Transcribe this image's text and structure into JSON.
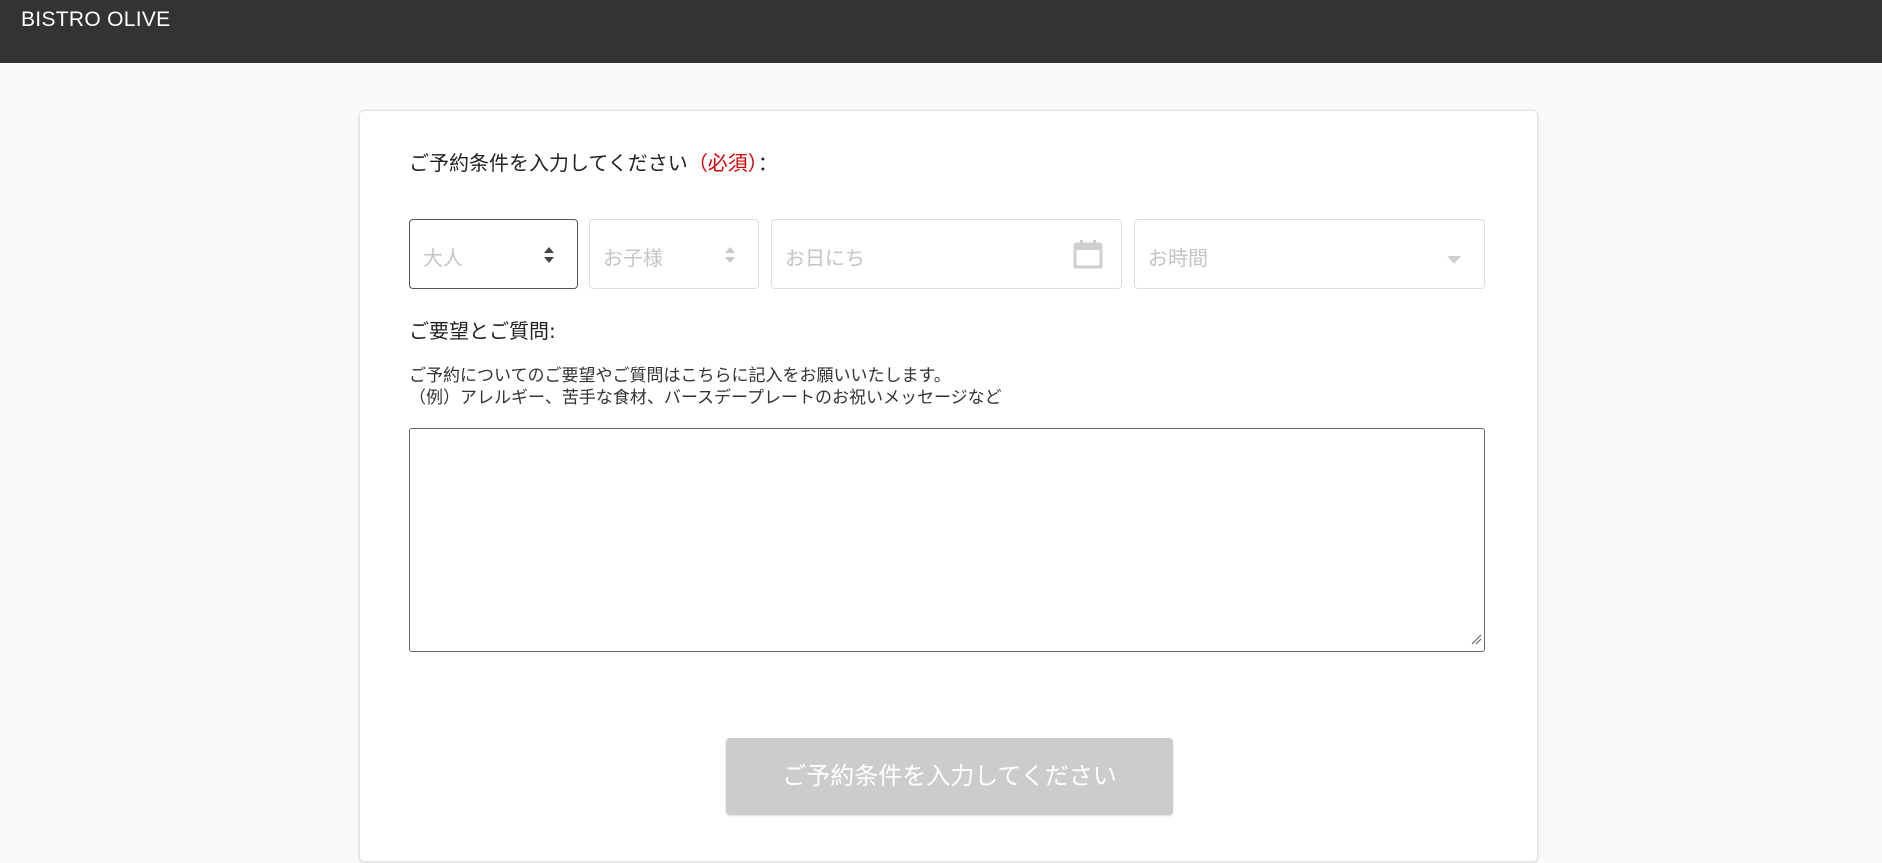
{
  "header": {
    "brand": "BISTRO OLIVE"
  },
  "reservation": {
    "conditions_label": "ご予約条件を入力してください",
    "required_label": "（必須）",
    "colon": "：",
    "adults_placeholder": "大人",
    "children_placeholder": "お子様",
    "date_placeholder": "お日にち",
    "time_placeholder": "お時間"
  },
  "requests": {
    "title": "ご要望とご質問:",
    "help_line1": "ご予約についてのご要望やご質問はこちらに記入をお願いいたします。",
    "help_line2": "（例）アレルギー、苦手な食材、バースデープレートのお祝いメッセージなど",
    "textarea_value": ""
  },
  "submit": {
    "label": "ご予約条件を入力してください",
    "enabled": false
  },
  "colors": {
    "header_bg": "#333333",
    "required_red": "#d40000",
    "disabled_button": "#cccccc"
  },
  "icons": {
    "stepper": "up-down-arrows-icon",
    "calendar": "calendar-icon",
    "dropdown": "chevron-down-icon"
  }
}
